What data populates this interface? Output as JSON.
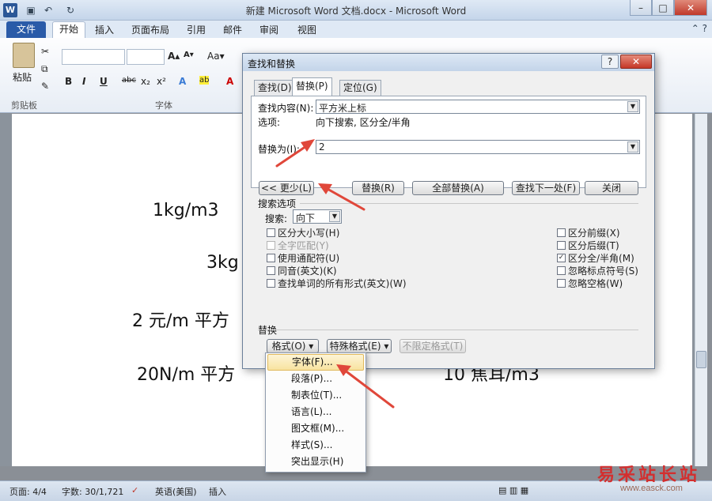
{
  "window": {
    "title": "新建 Microsoft Word 文档.docx - Microsoft Word",
    "logo": "W"
  },
  "ribbon": {
    "tabs": [
      "文件",
      "开始",
      "插入",
      "页面布局",
      "引用",
      "邮件",
      "审阅",
      "视图"
    ],
    "active_tab": "开始",
    "paste_label": "粘贴",
    "clipboard_label": "剪贴板",
    "font_group_label": "字体"
  },
  "document": {
    "lines": [
      "1kg/m3",
      "3kg",
      "2 元/m 平方",
      "20N/m 平方",
      "10 焦耳/m3"
    ]
  },
  "dialog": {
    "title": "查找和替换",
    "help_label": "?",
    "close_label": "✕",
    "tabs": [
      "查找(D)",
      "替换(P)",
      "定位(G)"
    ],
    "active_tab": "替换(P)",
    "find_label": "查找内容(N):",
    "find_value": "平方米上标",
    "options_label": "选项:",
    "options_value": "向下搜索, 区分全/半角",
    "replace_label": "替换为(I):",
    "replace_value": "2",
    "buttons": {
      "less": "<< 更少(L)",
      "replace": "替换(R)",
      "replace_all": "全部替换(A)",
      "find_next": "查找下一处(F)",
      "close": "关闭"
    },
    "search_options_title": "搜索选项",
    "search_label": "搜索:",
    "search_value": "向下",
    "left_checks": [
      {
        "label": "区分大小写(H)",
        "checked": false,
        "disabled": false
      },
      {
        "label": "全字匹配(Y)",
        "checked": false,
        "disabled": true
      },
      {
        "label": "使用通配符(U)",
        "checked": false,
        "disabled": false
      },
      {
        "label": "同音(英文)(K)",
        "checked": false,
        "disabled": false
      },
      {
        "label": "查找单词的所有形式(英文)(W)",
        "checked": false,
        "disabled": false
      }
    ],
    "right_checks": [
      {
        "label": "区分前缀(X)",
        "checked": false
      },
      {
        "label": "区分后缀(T)",
        "checked": false
      },
      {
        "label": "区分全/半角(M)",
        "checked": true
      },
      {
        "label": "忽略标点符号(S)",
        "checked": false
      },
      {
        "label": "忽略空格(W)",
        "checked": false
      }
    ],
    "replace_section_title": "替换",
    "format_button": "格式(O) ▾",
    "special_button": "特殊格式(E) ▾",
    "no_format_button": "不限定格式(T)"
  },
  "format_menu": {
    "items": [
      "字体(F)...",
      "段落(P)...",
      "制表位(T)...",
      "语言(L)...",
      "图文框(M)...",
      "样式(S)...",
      "突出显示(H)"
    ],
    "highlighted_index": 0
  },
  "statusbar": {
    "page": "页面: 4/4",
    "words": "字数: 30/1,721",
    "language": "英语(美国)",
    "mode": "插入"
  },
  "watermark": {
    "text": "易采站长站",
    "sub": "www.easck.com"
  },
  "colors": {
    "accent": "#2a5ba8",
    "arrow": "#e0473a",
    "highlight": "#f8e3a0"
  }
}
